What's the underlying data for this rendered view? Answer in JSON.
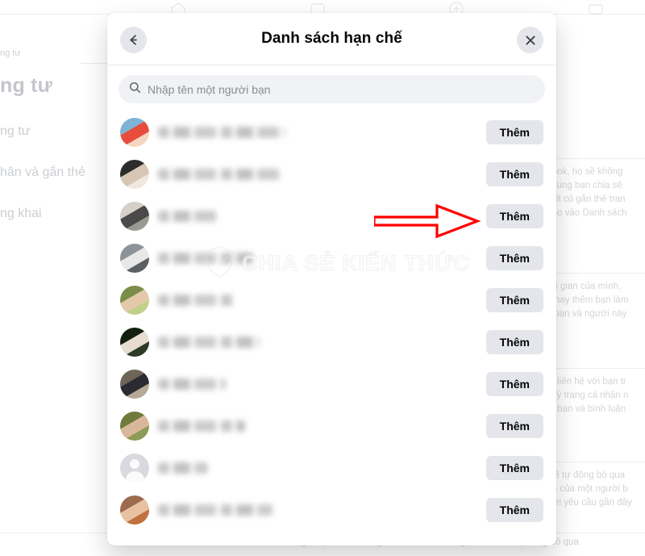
{
  "modal": {
    "title": "Danh sách hạn chế",
    "back_icon": "arrow-left-icon",
    "close_icon": "close-icon",
    "search": {
      "placeholder": "Nhập tên một người bạn",
      "value": "",
      "icon": "search-icon"
    },
    "friends": [
      {
        "name_redacted": "████ ██████ ███████",
        "name_width": 158,
        "avatar_type": "photo",
        "avatar_colors": [
          "#7fb3d5",
          "#e74c3c",
          "#f5d6c0"
        ],
        "action_label": "Thêm"
      },
      {
        "name_redacted": "█████ ███████ ████",
        "name_width": 152,
        "avatar_type": "photo",
        "avatar_colors": [
          "#2c2c2c",
          "#d8c6b4",
          "#f0e8e0"
        ],
        "action_label": "Thêm"
      },
      {
        "name_redacted": "███████",
        "name_width": 74,
        "avatar_type": "photo",
        "avatar_colors": [
          "#d5d0c8",
          "#4a4a4a",
          "#9a9a92"
        ],
        "action_label": "Thêm"
      },
      {
        "name_redacted": "███ ████ ████",
        "name_width": 118,
        "avatar_type": "photo",
        "avatar_colors": [
          "#8d9399",
          "#e8e8e8",
          "#5b6065"
        ],
        "action_label": "Thêm"
      },
      {
        "name_redacted": "██████ ████",
        "name_width": 96,
        "avatar_type": "photo",
        "avatar_colors": [
          "#7b8d4a",
          "#e3c9a8",
          "#c2d18a"
        ],
        "action_label": "Thêm"
      },
      {
        "name_redacted": "█████ ███ ████",
        "name_width": 126,
        "avatar_type": "photo",
        "avatar_colors": [
          "#14200f",
          "#e6ddd0",
          "#2d3a26"
        ],
        "action_label": "Thêm"
      },
      {
        "name_redacted": "█████ ███",
        "name_width": 84,
        "avatar_type": "photo",
        "avatar_colors": [
          "#6e6458",
          "#2a2a33",
          "#b5a895"
        ],
        "action_label": "Thêm"
      },
      {
        "name_redacted": "████ ██████",
        "name_width": 108,
        "avatar_type": "photo",
        "avatar_colors": [
          "#6f7a3c",
          "#d9b79a",
          "#8c9b55"
        ],
        "action_label": "Thêm"
      },
      {
        "name_redacted": "██████",
        "name_width": 62,
        "avatar_type": "placeholder",
        "avatar_colors": [
          "#d8dadf"
        ],
        "action_label": "Thêm"
      },
      {
        "name_redacted": "███ ████ ███████",
        "name_width": 142,
        "avatar_type": "photo",
        "avatar_colors": [
          "#9c6b4f",
          "#e8c2a0",
          "#c2703f"
        ],
        "action_label": "Thêm"
      }
    ]
  },
  "annotation": {
    "arrow_color": "#ff0000",
    "arrow_points_at": "Thêm"
  },
  "watermark": {
    "text": "CHIA SẺ KIẾN THỨC",
    "logo": "shield-logo-icon"
  },
  "background": {
    "left_panel": {
      "breadcrumb": "ng tư",
      "title": "ng tư",
      "nav_items": [
        "ng tư",
        "hân và gắn thẻ",
        "ng khai"
      ]
    },
    "right_panel": {
      "cards": [
        {
          "lines": [
            "ebook, họ sẽ không",
            "ội dung bạn chia sẻ",
            "i viết có gắn thẻ tran",
            "m họ vào Danh sách"
          ]
        },
        {
          "lines": [
            "thời gian của mình,",
            "ạn hay thêm bạn làm",
            "cả bạn và người này"
          ]
        },
        {
          "lines": [
            "thể liên hệ với bạn tr",
            "ất kỳ trang cá nhân n",
            "thẻ bạn và bình luận"
          ]
        },
        {
          "lines": [
            "n sẽ tự động bỏ qua",
            "hân của một người b",
            "dưới yêu cầu gần đây"
          ]
        }
      ]
    },
    "bottom_note": "Khi bạn chặn lời mời tham gia sự kiện từ trang cá nhân của một người, bạn sẽ tự động bỏ qua",
    "top_nav_icons": [
      "home-icon",
      "video-icon",
      "marketplace-icon",
      "groups-icon"
    ]
  }
}
